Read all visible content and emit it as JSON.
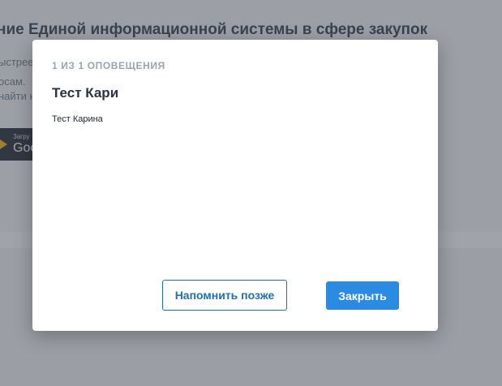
{
  "background": {
    "heading": "ние Единой информационной системы в сфере закупок",
    "line1": "ыстрее",
    "line2": "осам. ",
    "line3": "найти н",
    "store_small": "Загру",
    "store_big": "Goo"
  },
  "modal": {
    "counter": "1 ИЗ 1 ОПОВЕЩЕНИЯ",
    "title": "Тест Кари",
    "body": "Тест Карина",
    "remind_label": "Напомнить позже",
    "close_label": "Закрыть"
  },
  "colors": {
    "accent": "#2b8ae2",
    "outline": "#1f6fb6",
    "overlay": "rgba(70,76,86,0.5)"
  }
}
